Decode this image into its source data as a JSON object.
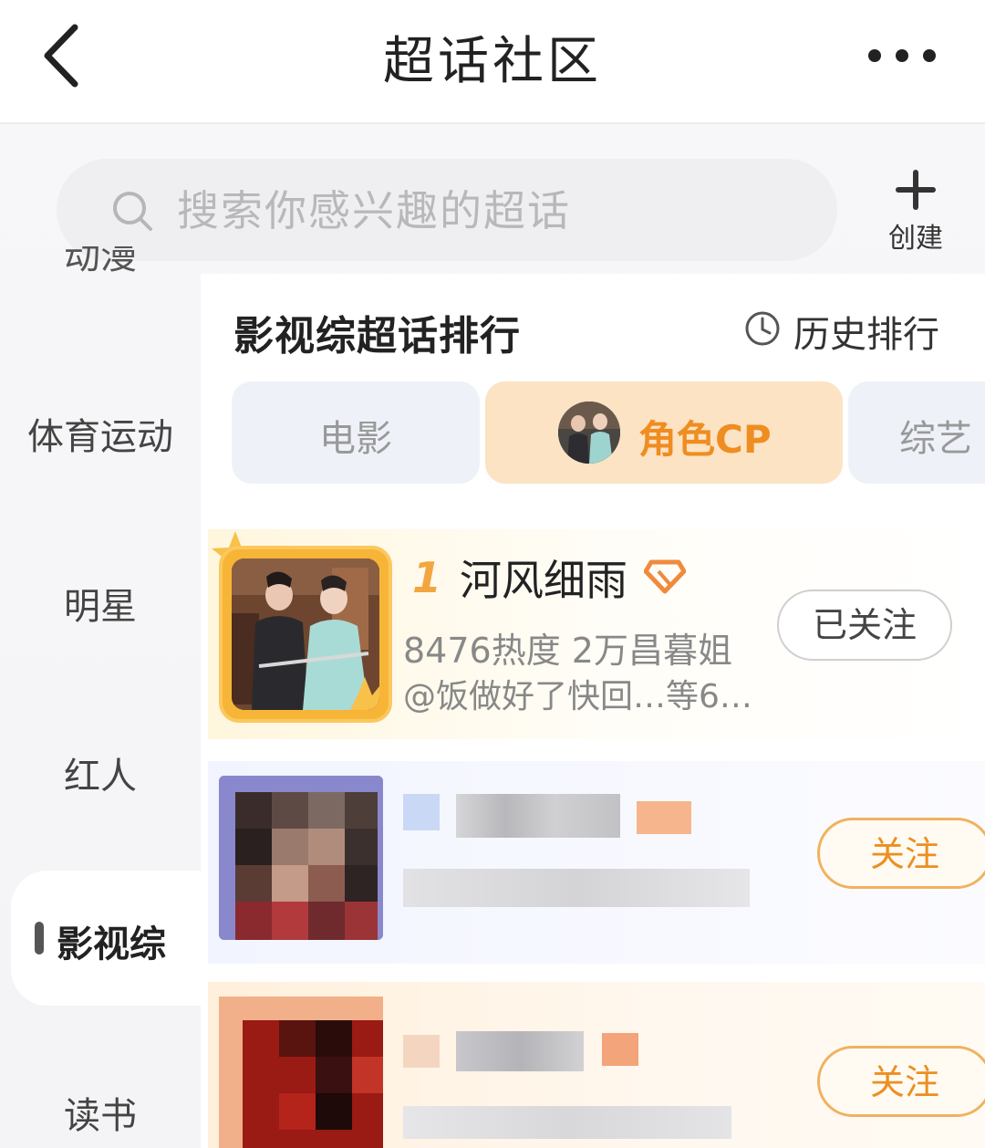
{
  "nav": {
    "title": "超话社区"
  },
  "search": {
    "placeholder": "搜索你感兴趣的超话"
  },
  "create": {
    "label": "创建"
  },
  "sidebar": {
    "items": [
      {
        "label": "动漫"
      },
      {
        "label": "体育运动"
      },
      {
        "label": "明星"
      },
      {
        "label": "红人"
      },
      {
        "label": "影视综"
      },
      {
        "label": "读书"
      }
    ],
    "active": "影视综"
  },
  "ranking": {
    "title": "影视综超话排行",
    "history_label": "历史排行",
    "tabs": [
      {
        "label": "电影"
      },
      {
        "label": "角色CP"
      },
      {
        "label": "综艺"
      }
    ],
    "items": [
      {
        "rank": "1",
        "name": "河风细雨",
        "stats": "8476热度 2万昌暮姐",
        "fans": "@饭做好了快回…等6…",
        "button": "已关注"
      },
      {
        "button": "关注"
      },
      {
        "button": "关注"
      }
    ]
  },
  "colors": {
    "accent": "#ef8d21",
    "cp_tab_bg": "#fbe3c4",
    "tab_bg": "#eef2f8"
  }
}
